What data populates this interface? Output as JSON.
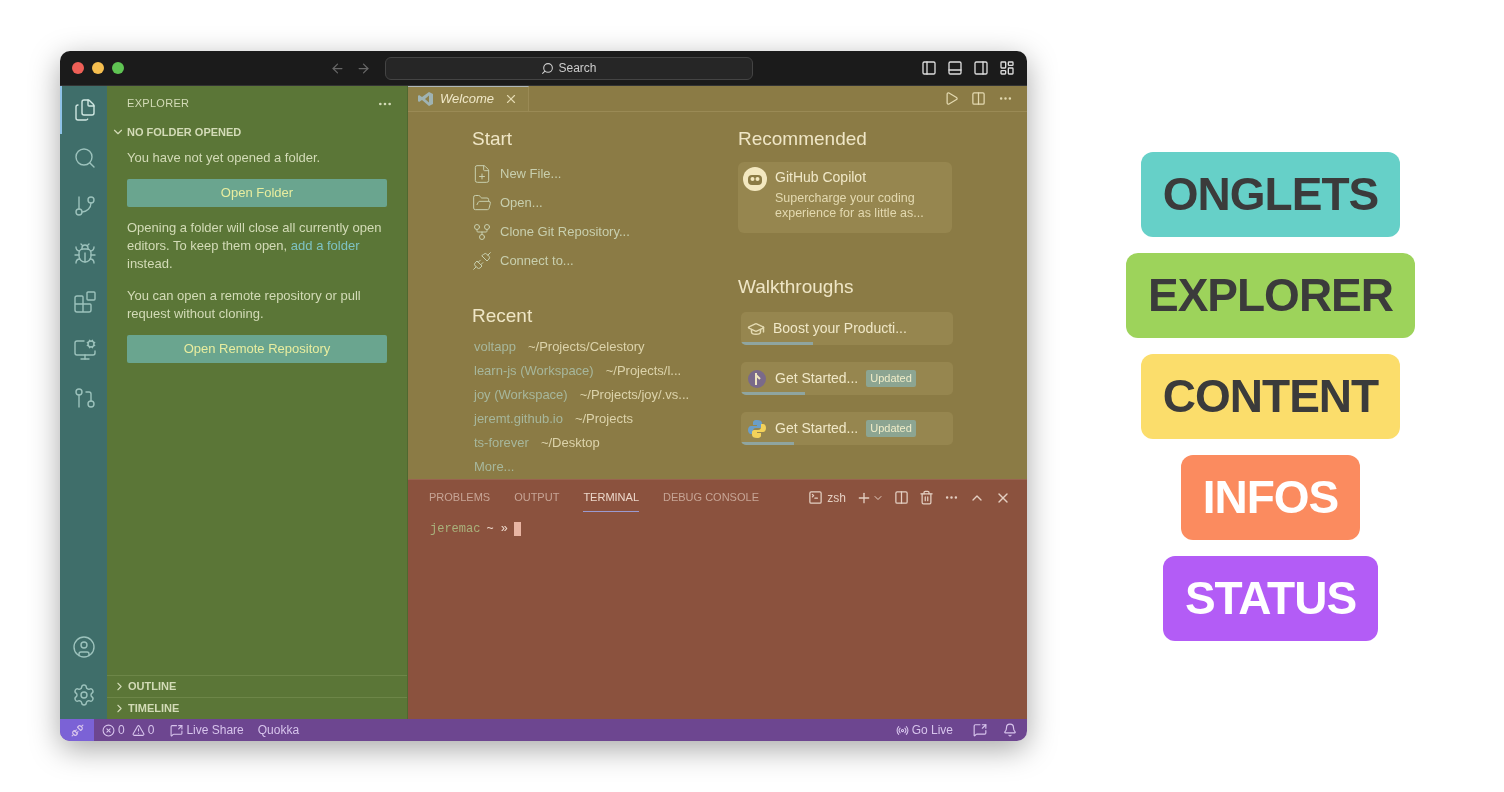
{
  "title_bar": {
    "search": "Search"
  },
  "activity_bar": [
    {
      "kind": "files",
      "selected": true
    },
    {
      "kind": "search",
      "selected": false
    },
    {
      "kind": "source-control",
      "selected": false
    },
    {
      "kind": "run",
      "selected": false
    },
    {
      "kind": "extensions",
      "selected": false
    },
    {
      "kind": "remote",
      "selected": false
    },
    {
      "kind": "pull-request",
      "selected": false
    }
  ],
  "activity_bar_bottom": [
    {
      "kind": "account"
    },
    {
      "kind": "settings"
    }
  ],
  "sidebar": {
    "title": "EXPLORER",
    "section": {
      "title": "NO FOLDER OPENED",
      "expanded": true
    },
    "message": "You have not yet opened a folder.",
    "open_folder_button": "Open Folder",
    "note": {
      "before": "Opening a folder will close all currently open editors. To keep them open,",
      "link": "add a folder",
      "after": "instead."
    },
    "remote_message": "You can open a remote repository or pull request without cloning.",
    "open_remote_button": "Open Remote Repository",
    "bottom_sections": [
      {
        "title": "OUTLINE",
        "expanded": false
      },
      {
        "title": "TIMELINE",
        "expanded": false
      }
    ]
  },
  "editor": {
    "tabs": [
      {
        "label": "Welcome",
        "selected": true
      }
    ],
    "start": {
      "title": "Start",
      "items": [
        {
          "kind": "new-file",
          "label": "New File..."
        },
        {
          "kind": "open",
          "label": "Open..."
        },
        {
          "kind": "clone",
          "label": "Clone Git Repository..."
        },
        {
          "kind": "connect",
          "label": "Connect to..."
        }
      ]
    },
    "recent": {
      "title": "Recent",
      "items": [
        {
          "name": "voltapp",
          "path": "~/Projects/Celestory"
        },
        {
          "name": "learn-js (Workspace)",
          "path": "~/Projects/l..."
        },
        {
          "name": "joy (Workspace)",
          "path": "~/Projects/joy/.vs..."
        },
        {
          "name": "jeremt.github.io",
          "path": "~/Projects"
        },
        {
          "name": "ts-forever",
          "path": "~/Desktop"
        }
      ],
      "more": "More..."
    },
    "recommended": {
      "title": "Recommended",
      "card": {
        "title": "GitHub Copilot",
        "description": "Supercharge your coding experience for as little as..."
      }
    },
    "walkthroughs": {
      "title": "Walkthroughs",
      "items": [
        {
          "kind": "learn",
          "title": "Boost your Producti...",
          "level": 0.34
        },
        {
          "kind": "git",
          "title": "Get Started...",
          "badge": "Updated",
          "level": 0.3
        },
        {
          "kind": "python",
          "title": "Get Started...",
          "badge": "Updated",
          "level": 0.25
        }
      ]
    }
  },
  "panel": {
    "tabs": [
      {
        "label": "PROBLEMS",
        "selected": false
      },
      {
        "label": "OUTPUT",
        "selected": false
      },
      {
        "label": "TERMINAL",
        "selected": true
      },
      {
        "label": "DEBUG CONSOLE",
        "selected": false
      }
    ],
    "shell": "zsh",
    "prompt": {
      "user": "jeremac",
      "rest": "~ »"
    }
  },
  "status_bar": {
    "errors": "0",
    "warnings": "0",
    "live_share": "Live Share",
    "quokka": "Quokka",
    "go_live": "Go Live"
  },
  "legend": [
    {
      "label": "ONGLETS",
      "color": "#66d0c8"
    },
    {
      "label": "EXPLORER",
      "color": "#9dd35b"
    },
    {
      "label": "CONTENT",
      "color": "#fbdd6b"
    },
    {
      "label": "INFOS",
      "color": "#fb8b5f"
    },
    {
      "label": "STATUS",
      "color": "#b35cf6"
    }
  ]
}
